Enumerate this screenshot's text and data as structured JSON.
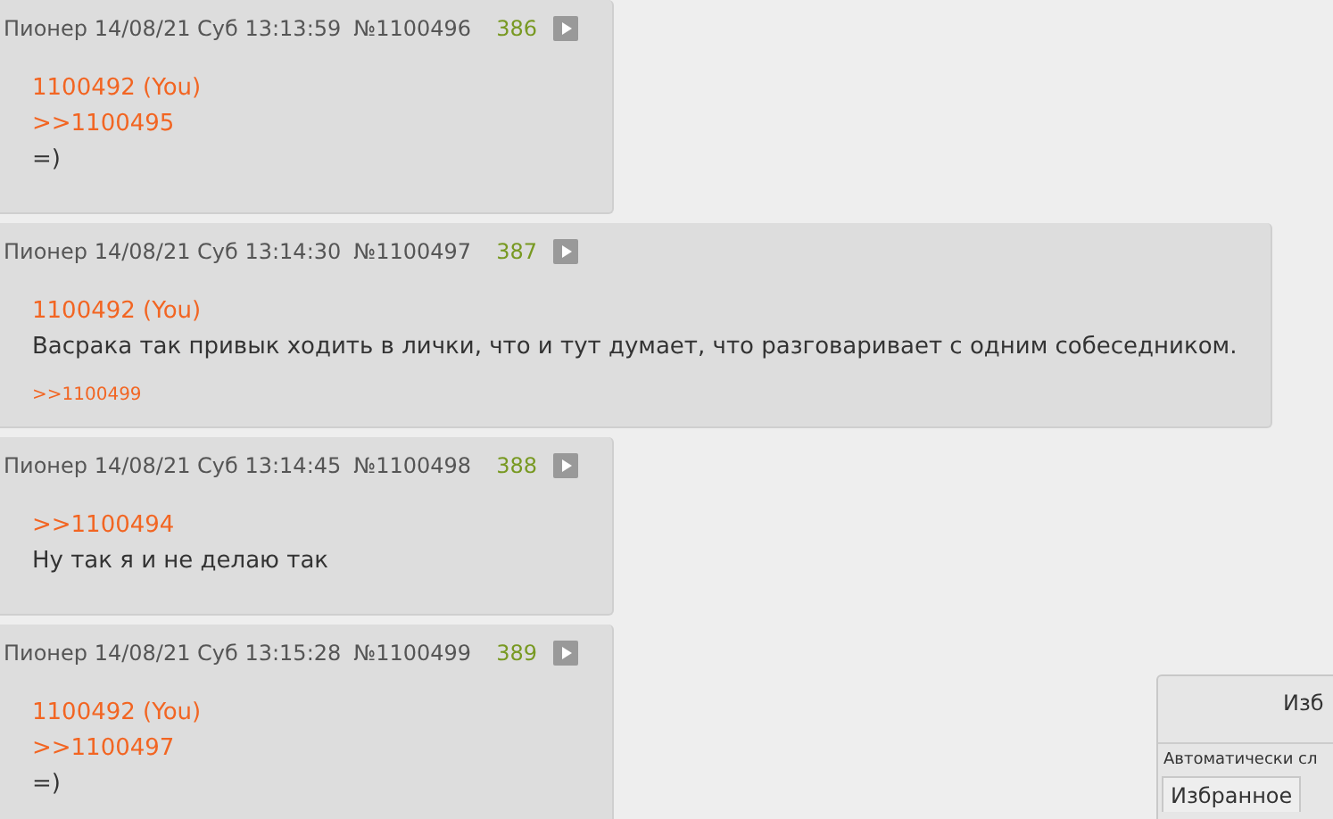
{
  "posts": [
    {
      "author": "Пионер",
      "date": "14/08/21 Суб 13:13:59",
      "number": "№1100496",
      "index": "386",
      "lines": [
        {
          "kind": "you",
          "text": "1100492 (You)"
        },
        {
          "kind": "reply",
          "text": ">>1100495"
        },
        {
          "kind": "text",
          "text": "=)"
        }
      ]
    },
    {
      "author": "Пионер",
      "date": "14/08/21 Суб 13:14:30",
      "number": "№1100497",
      "index": "387",
      "lines": [
        {
          "kind": "you",
          "text": "1100492 (You)"
        },
        {
          "kind": "text",
          "text": "Васрака так привык ходить в лички, что и тут думает, что разговаривает с одним собеседником."
        }
      ],
      "backlinks": [
        ">>1100499"
      ]
    },
    {
      "author": "Пионер",
      "date": "14/08/21 Суб 13:14:45",
      "number": "№1100498",
      "index": "388",
      "lines": [
        {
          "kind": "reply",
          "text": ">>1100494"
        },
        {
          "kind": "text",
          "text": "Ну так я и не делаю так"
        }
      ]
    },
    {
      "author": "Пионер",
      "date": "14/08/21 Суб 13:15:28",
      "number": "№1100499",
      "index": "389",
      "lines": [
        {
          "kind": "you",
          "text": "1100492 (You)"
        },
        {
          "kind": "reply",
          "text": ">>1100497"
        },
        {
          "kind": "text",
          "text": "=)"
        }
      ]
    }
  ],
  "panel": {
    "title": "Изб",
    "subtitle": "Автоматически сл",
    "tabs": [
      {
        "label": "Избранное"
      }
    ]
  }
}
